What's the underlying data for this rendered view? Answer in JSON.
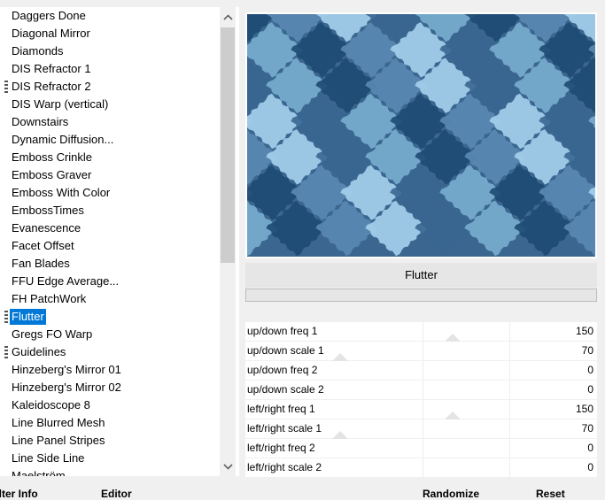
{
  "filter_list": {
    "items": [
      {
        "label": "Daggers Done",
        "grip": false,
        "selected": false
      },
      {
        "label": "Diagonal Mirror",
        "grip": false,
        "selected": false
      },
      {
        "label": "Diamonds",
        "grip": false,
        "selected": false
      },
      {
        "label": "DIS Refractor 1",
        "grip": false,
        "selected": false
      },
      {
        "label": "DIS Refractor 2",
        "grip": true,
        "selected": false
      },
      {
        "label": "DIS Warp (vertical)",
        "grip": false,
        "selected": false
      },
      {
        "label": "Downstairs",
        "grip": false,
        "selected": false
      },
      {
        "label": "Dynamic Diffusion...",
        "grip": false,
        "selected": false
      },
      {
        "label": "Emboss Crinkle",
        "grip": false,
        "selected": false
      },
      {
        "label": "Emboss Graver",
        "grip": false,
        "selected": false
      },
      {
        "label": "Emboss With Color",
        "grip": false,
        "selected": false
      },
      {
        "label": "EmbossTimes",
        "grip": false,
        "selected": false
      },
      {
        "label": "Evanescence",
        "grip": false,
        "selected": false
      },
      {
        "label": "Facet Offset",
        "grip": false,
        "selected": false
      },
      {
        "label": "Fan Blades",
        "grip": false,
        "selected": false
      },
      {
        "label": "FFU Edge Average...",
        "grip": false,
        "selected": false
      },
      {
        "label": "FH PatchWork",
        "grip": false,
        "selected": false
      },
      {
        "label": "Flutter",
        "grip": true,
        "selected": true
      },
      {
        "label": "Gregs FO Warp",
        "grip": false,
        "selected": false
      },
      {
        "label": "Guidelines",
        "grip": true,
        "selected": false
      },
      {
        "label": "Hinzeberg's Mirror 01",
        "grip": false,
        "selected": false
      },
      {
        "label": "Hinzeberg's Mirror 02",
        "grip": false,
        "selected": false
      },
      {
        "label": "Kaleidoscope 8",
        "grip": false,
        "selected": false
      },
      {
        "label": "Line Blurred Mesh",
        "grip": false,
        "selected": false
      },
      {
        "label": "Line Panel Stripes",
        "grip": false,
        "selected": false
      },
      {
        "label": "Line Side Line",
        "grip": false,
        "selected": false
      },
      {
        "label": "Maelström",
        "grip": false,
        "selected": false
      }
    ],
    "scroll_up_icon": "chevron-up-icon",
    "scroll_down_icon": "chevron-down-icon"
  },
  "bottom_tabs": {
    "filter_info": "Filter Info",
    "editor": "Editor"
  },
  "preview": {
    "colors": [
      "#1e4a72",
      "#3a6690",
      "#5a8ab2",
      "#7aaed0",
      "#a6d2ee"
    ]
  },
  "filter_name": "Flutter",
  "params": [
    {
      "label": "up/down freq 1",
      "value": "150",
      "level": 0.59
    },
    {
      "label": "up/down scale 1",
      "value": "70",
      "level": 0.27
    },
    {
      "label": "up/down freq 2",
      "value": "0",
      "level": 0.0
    },
    {
      "label": "up/down scale 2",
      "value": "0",
      "level": 0.0
    },
    {
      "label": "left/right freq 1",
      "value": "150",
      "level": 0.59
    },
    {
      "label": "left/right scale 1",
      "value": "70",
      "level": 0.27
    },
    {
      "label": "left/right freq 2",
      "value": "0",
      "level": 0.0
    },
    {
      "label": "left/right scale 2",
      "value": "0",
      "level": 0.0
    }
  ],
  "buttons": {
    "randomize": "Randomize",
    "reset": "Reset"
  }
}
